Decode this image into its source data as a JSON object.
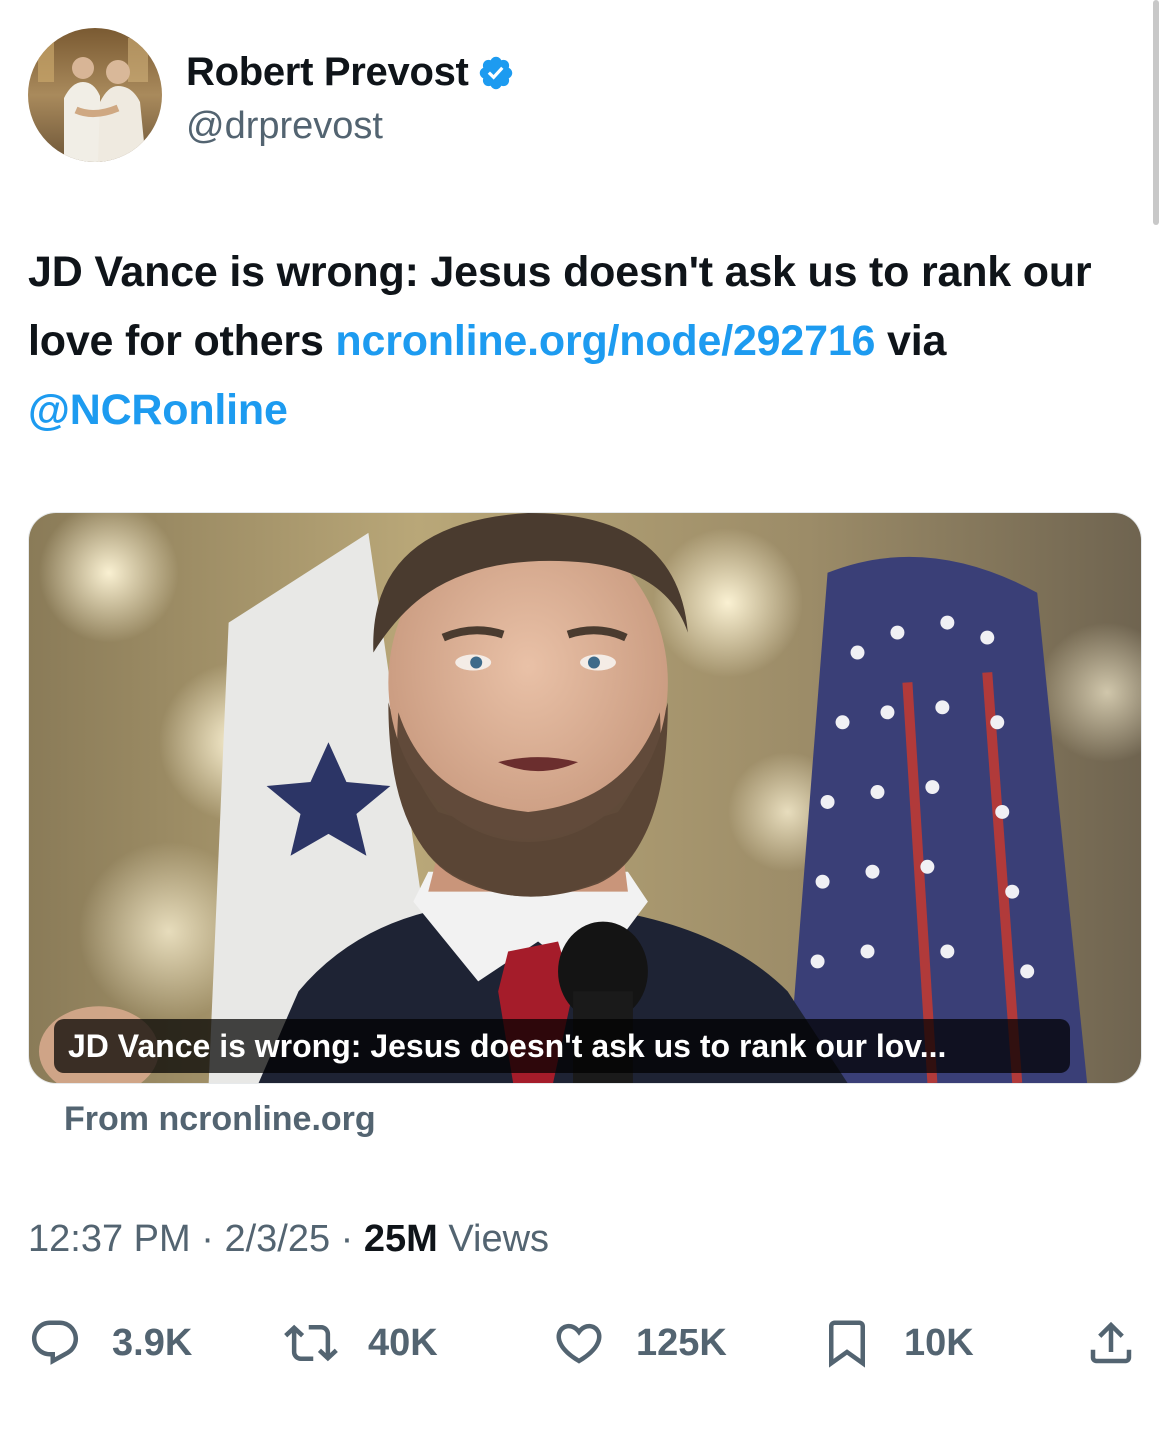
{
  "author": {
    "display_name": "Robert Prevost",
    "handle": "@drprevost",
    "verified": true,
    "verified_color": "#1d9bf0"
  },
  "tweet": {
    "text_plain": "JD Vance is wrong: Jesus doesn't ask us to rank our love for others ",
    "link_text": "ncronline.org/node/292716",
    "via_text": " via ",
    "mention": "@NCRonline",
    "link_color": "#1d9bf0"
  },
  "card": {
    "caption": "JD Vance is wrong: Jesus doesn't ask us to rank our lov...",
    "source": "From ncronline.org"
  },
  "meta": {
    "time": "12:37 PM",
    "separator": " · ",
    "date": "2/3/25",
    "views_count": "25M",
    "views_label": " Views"
  },
  "actions": [
    {
      "icon": "reply-icon",
      "count": "3.9K"
    },
    {
      "icon": "retweet-icon",
      "count": "40K"
    },
    {
      "icon": "like-icon",
      "count": "125K"
    },
    {
      "icon": "bookmark-icon",
      "count": "10K"
    },
    {
      "icon": "share-icon",
      "count": ""
    }
  ]
}
